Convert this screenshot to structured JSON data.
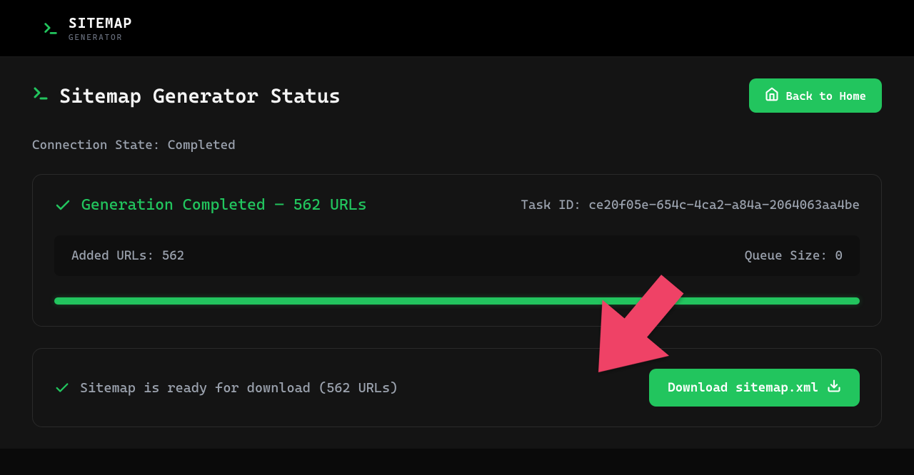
{
  "header": {
    "logo_title": "SITEMAP",
    "logo_subtitle": "GENERATOR"
  },
  "page": {
    "title": "Sitemap Generator Status",
    "back_button": "Back to Home",
    "connection_label": "Connection State:",
    "connection_value": "Completed"
  },
  "status": {
    "completion_text": "Generation Completed — 562 URLs",
    "task_id_label": "Task ID:",
    "task_id_value": "ce20f05e-654c-4ca2-a84a-2064063aa4be",
    "added_urls_label": "Added URLs:",
    "added_urls_value": "562",
    "queue_size_label": "Queue Size:",
    "queue_size_value": "0"
  },
  "download": {
    "ready_text": "Sitemap is ready for download (562 URLs)",
    "button_label": "Download sitemap.xml"
  }
}
